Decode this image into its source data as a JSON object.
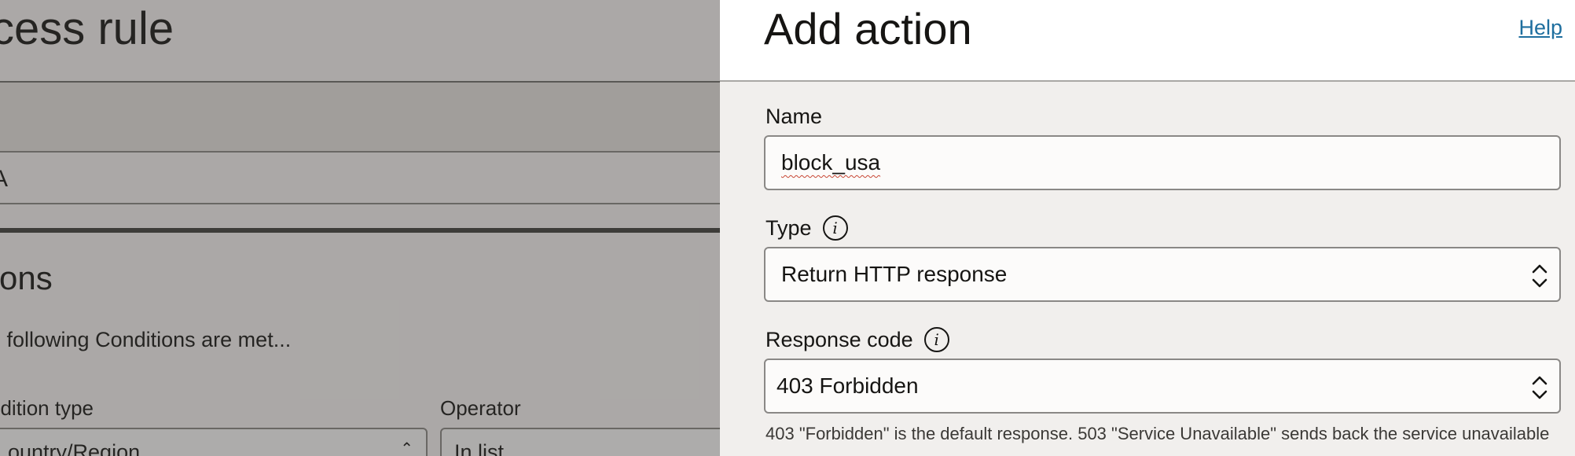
{
  "background": {
    "title": "ccess rule",
    "value": "A",
    "heading": "tions",
    "subtitle": "e following Conditions are met...",
    "condition_type_label": "ndition type",
    "operator_label": "Operator",
    "condition_type_value": "ountry/Region",
    "operator_value": "In list"
  },
  "drawer": {
    "title": "Add action",
    "help_link": "Help",
    "name": {
      "label": "Name",
      "value": "block_usa"
    },
    "type": {
      "label": "Type",
      "value": "Return HTTP response",
      "info_icon": "info-icon"
    },
    "response_code": {
      "label": "Response code",
      "value": "403 Forbidden",
      "info_icon": "info-icon",
      "help_text": "403 \"Forbidden\" is the default response. 503 \"Service Unavailable\" sends back the service unavailable"
    }
  },
  "colors": {
    "link": "#1f6f9f",
    "drawer_background": "#f1efed",
    "spellcheck_underline": "#c74634"
  }
}
